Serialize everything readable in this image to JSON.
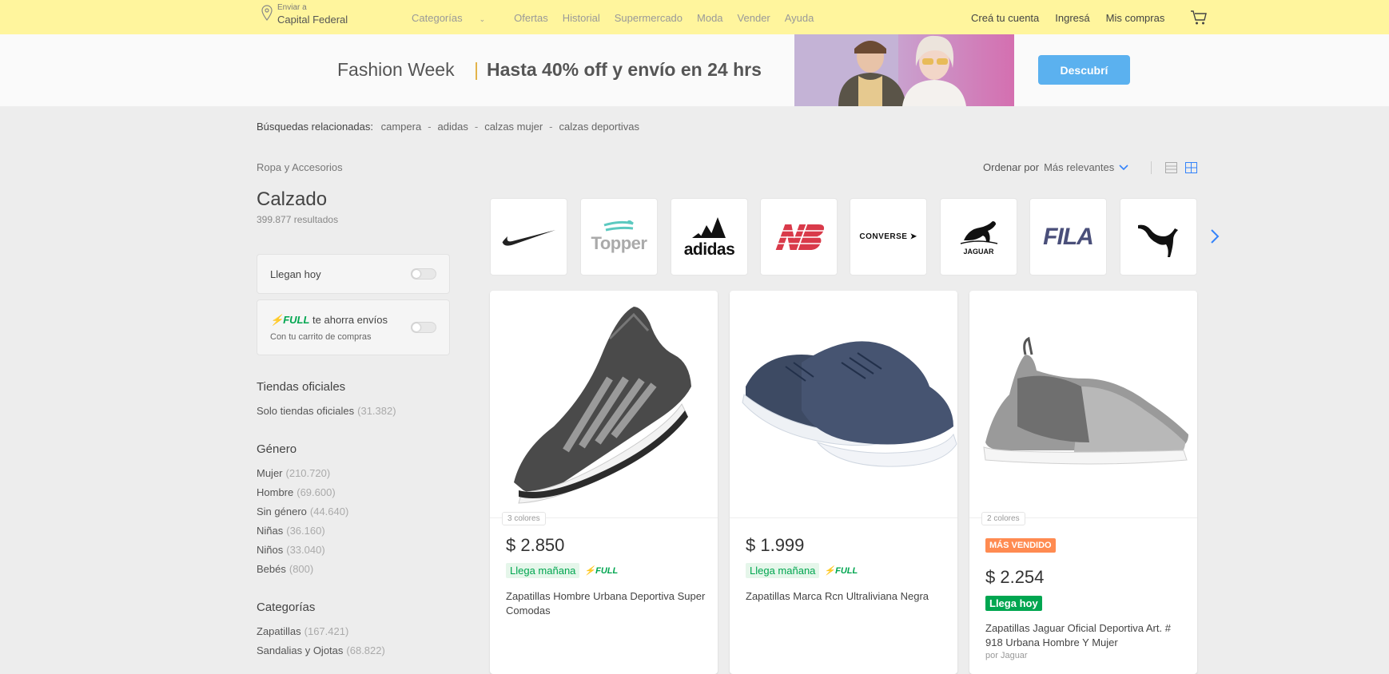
{
  "header": {
    "deliver_small": "Enviar a",
    "deliver_city": "Capital Federal",
    "nav": [
      "Categorías",
      "Ofertas",
      "Historial",
      "Supermercado",
      "Moda",
      "Vender",
      "Ayuda"
    ],
    "user": {
      "create": "Creá tu cuenta",
      "login": "Ingresá",
      "purchases": "Mis compras"
    }
  },
  "banner": {
    "title": "Fashion Week",
    "offer": "Hasta 40% off y envío en 24 hrs",
    "button": "Descubrí"
  },
  "related": {
    "label": "Búsquedas relacionadas:",
    "terms": [
      "campera",
      "adidas",
      "calzas mujer",
      "calzas deportivas"
    ],
    "sep": "-"
  },
  "sidebar": {
    "breadcrumb": "Ropa y Accesorios",
    "title": "Calzado",
    "results": "399.877 resultados",
    "filter_today": "Llegan hoy",
    "filter_full": {
      "brand": "FULL",
      "text": "te ahorra envíos",
      "sub": "Con tu carrito de compras"
    },
    "official": {
      "heading": "Tiendas oficiales",
      "item": "Solo tiendas oficiales",
      "count": "(31.382)"
    },
    "gender": {
      "heading": "Género",
      "items": [
        {
          "label": "Mujer",
          "count": "(210.720)"
        },
        {
          "label": "Hombre",
          "count": "(69.600)"
        },
        {
          "label": "Sin género",
          "count": "(44.640)"
        },
        {
          "label": "Niñas",
          "count": "(36.160)"
        },
        {
          "label": "Niños",
          "count": "(33.040)"
        },
        {
          "label": "Bebés",
          "count": "(800)"
        }
      ]
    },
    "categories": {
      "heading": "Categorías",
      "items": [
        {
          "label": "Zapatillas",
          "count": "(167.421)"
        },
        {
          "label": "Sandalias y Ojotas",
          "count": "(68.822)"
        }
      ]
    }
  },
  "sort": {
    "label": "Ordenar por",
    "value": "Más relevantes"
  },
  "brands": [
    {
      "name": "Nike",
      "text": ""
    },
    {
      "name": "Topper",
      "text": "Topper"
    },
    {
      "name": "Adidas",
      "text": "adidas"
    },
    {
      "name": "New Balance",
      "text": ""
    },
    {
      "name": "Converse",
      "text": "CONVERSE"
    },
    {
      "name": "Jaguar",
      "text": "JAGUAR"
    },
    {
      "name": "Fila",
      "text": "FILA"
    },
    {
      "name": "Puma",
      "text": ""
    }
  ],
  "products": [
    {
      "colors": "3 colores",
      "price": "$ 2.850",
      "shipping": "Llega mañana",
      "full": "FULL",
      "title": "Zapatillas Hombre Urbana Deportiva Super Comodas"
    },
    {
      "price": "$ 1.999",
      "shipping": "Llega mañana",
      "full": "FULL",
      "title": "Zapatillas Marca Rcn Ultraliviana Negra"
    },
    {
      "colors": "2 colores",
      "badge": "MÁS VENDIDO",
      "price": "$ 2.254",
      "shipping": "Llega hoy",
      "title": "Zapatillas Jaguar Oficial Deportiva Art. # 918 Urbana Hombre Y Mujer",
      "seller": "por Jaguar"
    }
  ],
  "colors": {
    "header": "#fff59d",
    "accent": "#3483fa",
    "green": "#00a650",
    "button": "#5bb1ef",
    "best_seller": "#ff7733"
  }
}
